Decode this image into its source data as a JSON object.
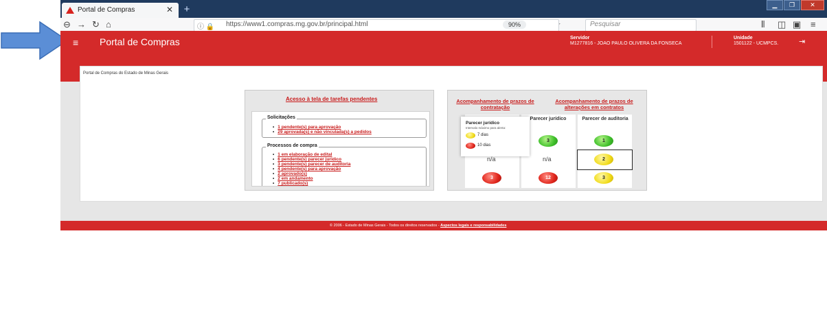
{
  "browser": {
    "tab_title": "Portal de Compras",
    "tab_close": "✕",
    "new_tab": "+",
    "url": "https://www1.compras.mg.gov.br/principal.html",
    "zoom": "90%",
    "search_placeholder": "Pesquisar"
  },
  "header": {
    "title": "Portal de Compras",
    "servidor_label": "Servidor",
    "servidor_value": "M1277816 - JOAO PAULO OLIVERA DA FONSECA",
    "unidade_label": "Unidade",
    "unidade_value": "1501122 - UCMPCS."
  },
  "breadcrumb": "Portal de Compras do Estado de Minas Gerais",
  "left_card": {
    "heading": "Acesso à tela de tarefas pendentes",
    "solicitacoes": {
      "legend": "Solicitações",
      "items": [
        "1 pendente(s) para aprovação",
        "29 aprovada(s) e não vinculada(s) a pedidos"
      ]
    },
    "processos": {
      "legend": "Processos de compra",
      "items": [
        "1 em elaboração de edital",
        "6 pendente(s) parecer jurídico",
        "3 pendente(s) parecer de auditoria",
        "4 pendente(s) para aprovação",
        "2 aprovado(s)",
        "2 em andamento",
        "7 publicado(s)"
      ]
    }
  },
  "right_card": {
    "heading_left": "Acompanhamento de prazos de contratação",
    "heading_right": "Acompanhamento de prazos de alterações em contratos",
    "col_juridico": "Parecer jurídico",
    "col_auditoria": "Parecer de auditoria",
    "row1": {
      "juridico": "3",
      "auditoria": "1"
    },
    "row2": {
      "first": "n/a",
      "juridico": "n/a",
      "auditoria": "2"
    },
    "row3": {
      "first": "3",
      "juridico": "12",
      "auditoria": "3"
    },
    "tooltip": {
      "title": "Parecer jurídico",
      "subtitle": "Intervalo máximo para alerta:",
      "yellow": "7 dias",
      "red": "10 dias"
    }
  },
  "footer": {
    "text": "© 2006 - Estado de Minas Gerais - Todos os direitos reservados - ",
    "link": "Aspectos legais e responsabilidades"
  }
}
